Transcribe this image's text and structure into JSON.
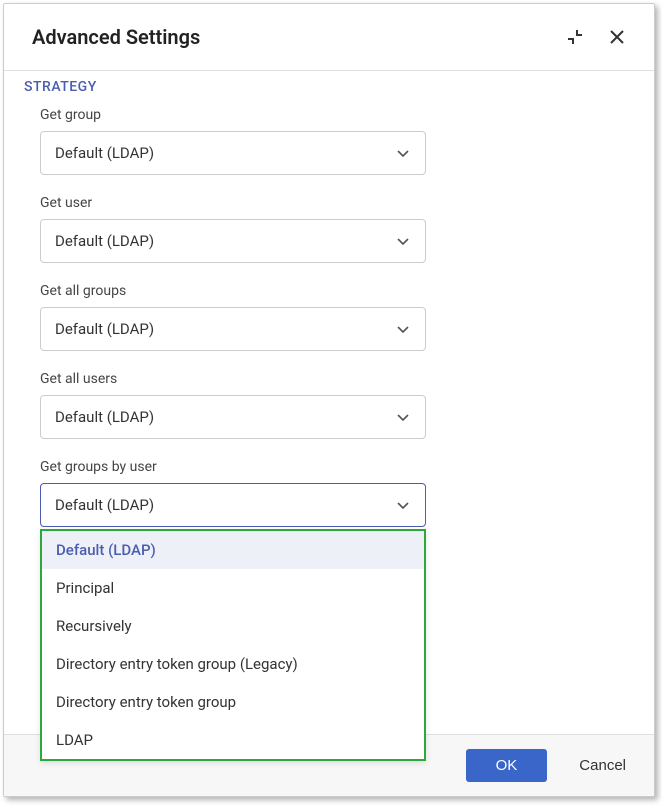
{
  "dialog": {
    "title": "Advanced Settings"
  },
  "section": {
    "label": "STRATEGY"
  },
  "fields": {
    "get_group": {
      "label": "Get group",
      "value": "Default (LDAP)"
    },
    "get_user": {
      "label": "Get user",
      "value": "Default (LDAP)"
    },
    "get_all_groups": {
      "label": "Get all groups",
      "value": "Default (LDAP)"
    },
    "get_all_users": {
      "label": "Get all users",
      "value": "Default (LDAP)"
    },
    "get_groups_by_user": {
      "label": "Get groups by user",
      "value": "Default (LDAP)",
      "options": [
        "Default (LDAP)",
        "Principal",
        "Recursively",
        "Directory entry token group (Legacy)",
        "Directory entry token group",
        "LDAP"
      ]
    }
  },
  "footer": {
    "ok": "OK",
    "cancel": "Cancel"
  }
}
